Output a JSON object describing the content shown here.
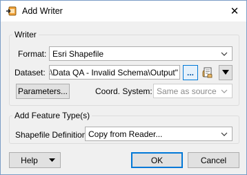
{
  "window": {
    "title": "Add Writer",
    "close_glyph": "✕"
  },
  "writer_group": {
    "label": "Writer",
    "format_label": "Format:",
    "format_value": "Esri Shapefile",
    "dataset_label": "Dataset:",
    "dataset_value": "tes\\Data QA - Invalid Schema\\Output\"",
    "browse_label": "...",
    "parameters_label": "Parameters...",
    "coord_label": "Coord. System:",
    "coord_value": "Same as source"
  },
  "feature_group": {
    "label": "Add Feature Type(s)",
    "shapefile_label": "Shapefile Definition:",
    "shapefile_value": "Copy from Reader..."
  },
  "footer": {
    "help_label": "Help",
    "ok_label": "OK",
    "cancel_label": "Cancel"
  },
  "icons": {
    "app": "fme-writer-icon",
    "close": "close-icon",
    "dropdown": "chevron-down-icon",
    "browse": "browse-dots-icon",
    "dataset_tools": "hand-document-icon",
    "dataset_menu": "triangle-down-icon"
  },
  "colors": {
    "accent": "#0078d7",
    "window_bg": "#f0f0f0",
    "disabled_text": "#8a8a8a"
  }
}
